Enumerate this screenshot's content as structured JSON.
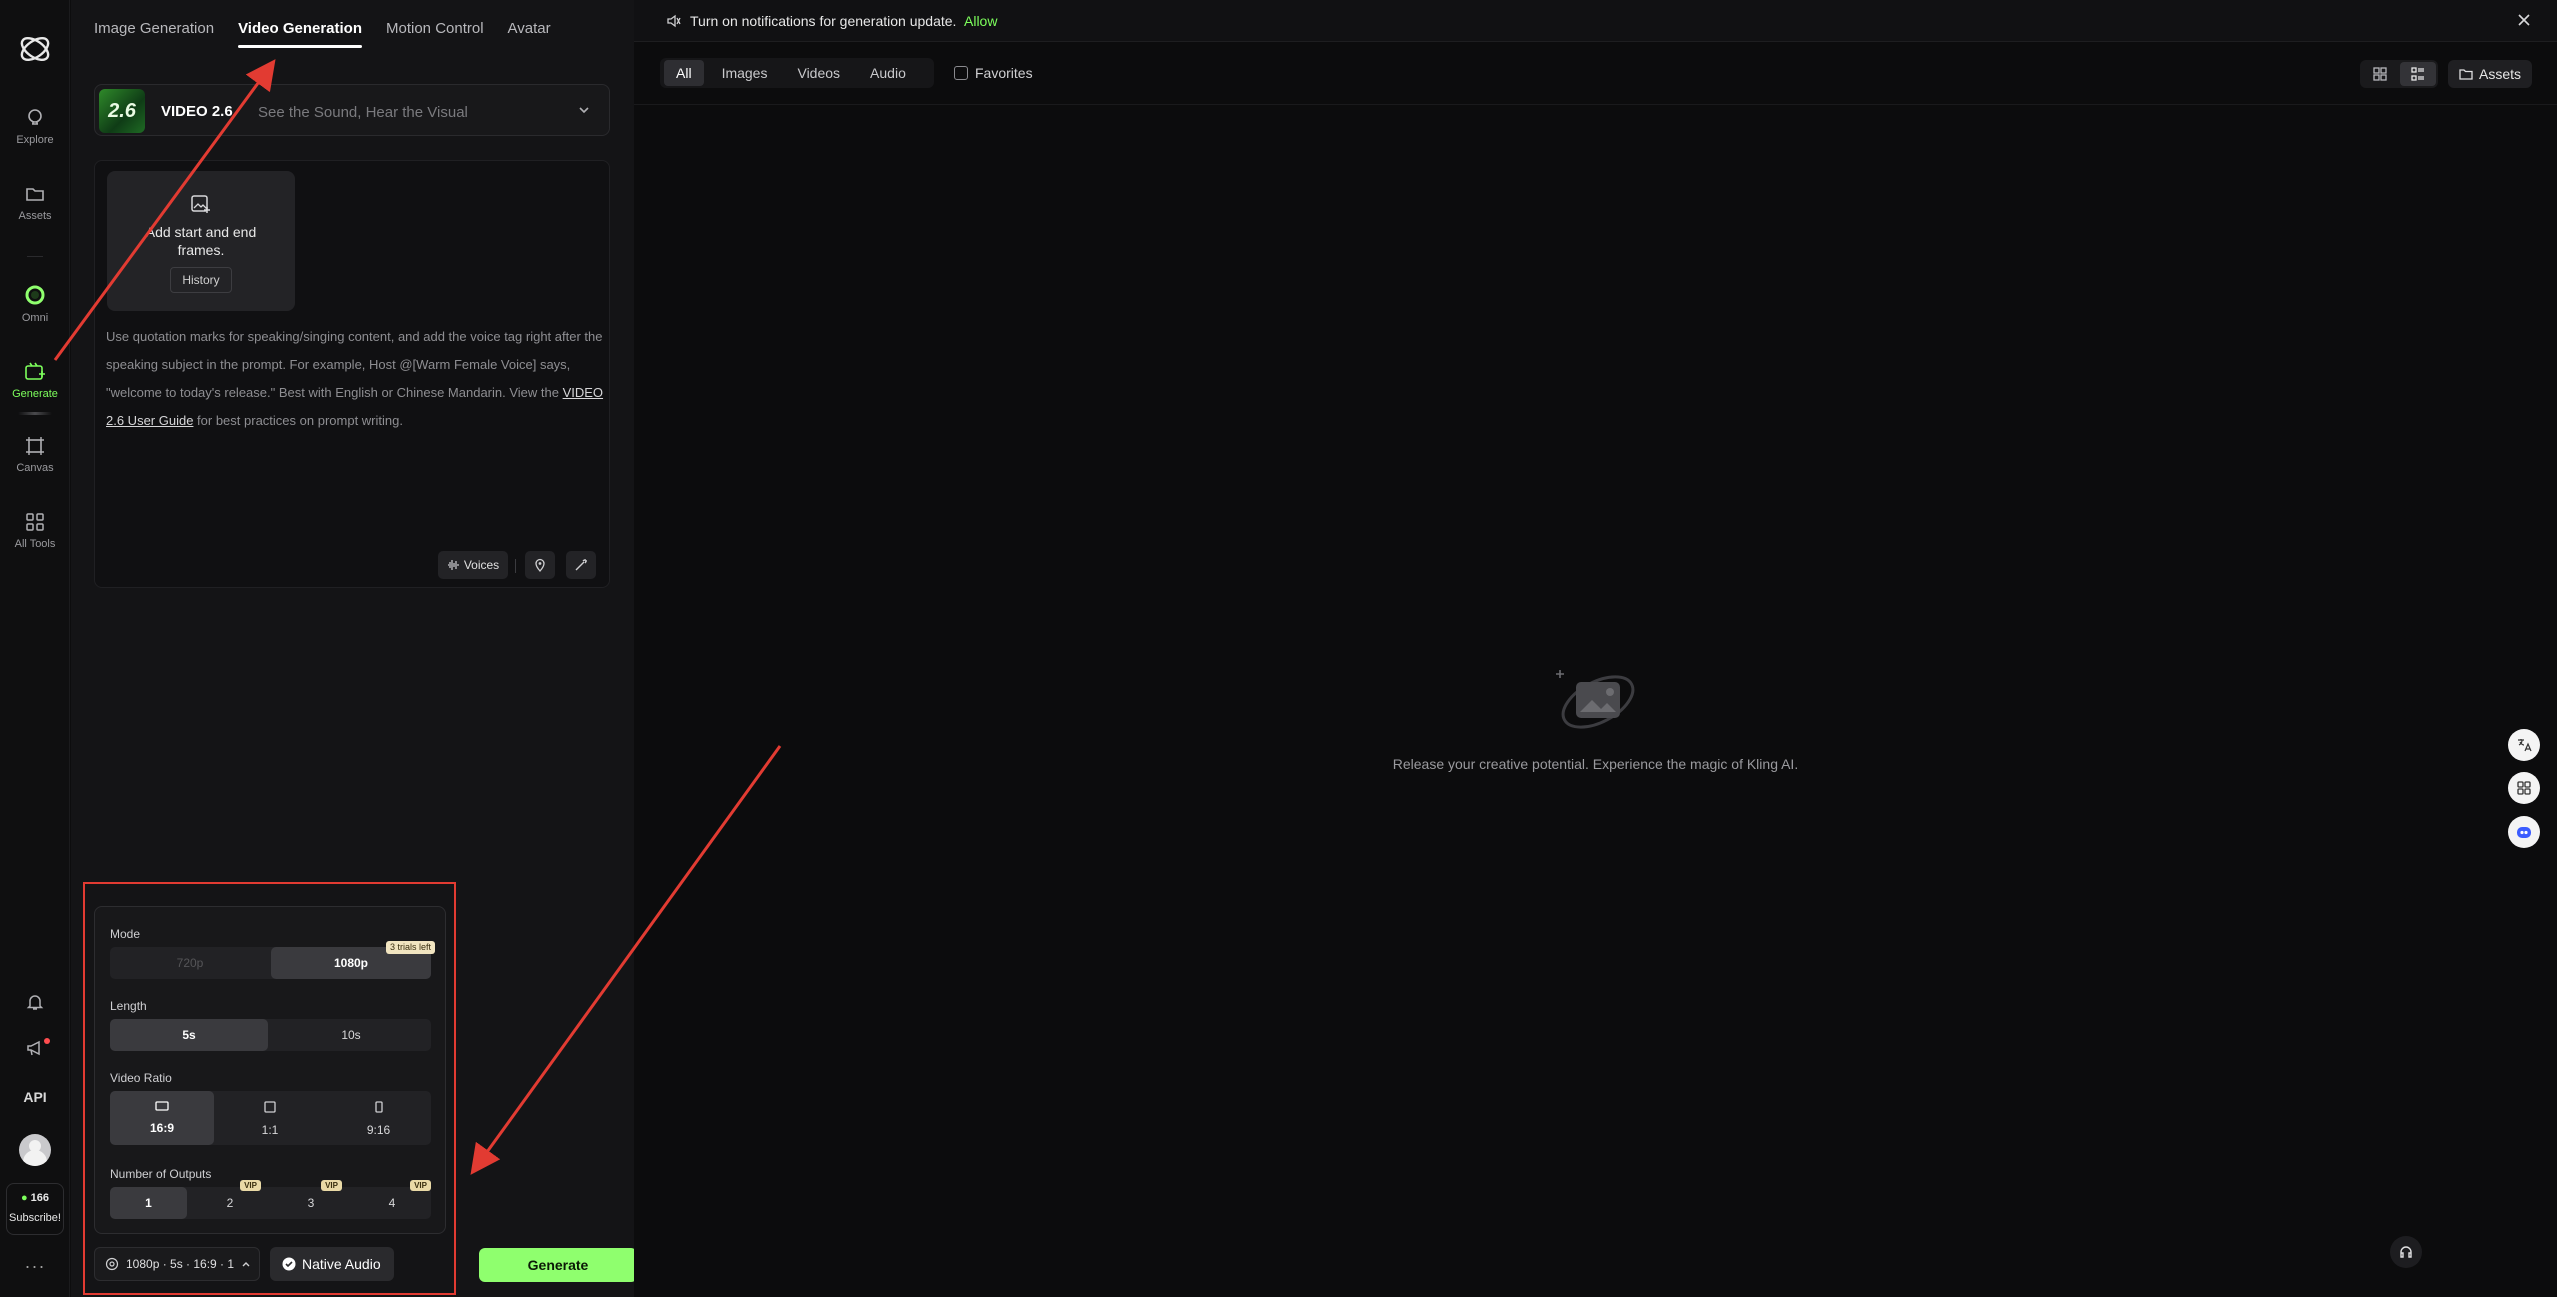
{
  "nav": {
    "items": [
      {
        "label": "Explore",
        "icon": "bulb-icon"
      },
      {
        "label": "Assets",
        "icon": "folder-icon"
      },
      {
        "label": "Omni",
        "icon": "omni-ring-icon"
      },
      {
        "label": "Generate",
        "icon": "generate-icon",
        "active": true
      },
      {
        "label": "Canvas",
        "icon": "canvas-icon"
      },
      {
        "label": "All Tools",
        "icon": "grid-icon"
      }
    ],
    "api_label": "API",
    "points": "166",
    "subscribe_label": "Subscribe!",
    "more": "···"
  },
  "tabs": [
    "Image Generation",
    "Video Generation",
    "Motion Control",
    "Avatar"
  ],
  "model": {
    "badge": "2.6",
    "name": "VIDEO 2.6",
    "tagline": "See the Sound, Hear the Visual"
  },
  "prompt": {
    "frames_label": "Add start and end frames.",
    "history_label": "History",
    "hint_text": "Use quotation marks for speaking/singing content, and add the voice tag right after the speaking subject in the prompt. For example, Host @[Warm Female Voice] says, \"welcome to today's release.\" Best with English or Chinese Mandarin. View the ",
    "guide_link": "VIDEO 2.6 User Guide",
    "hint_tail": " for best practices on prompt writing.",
    "voices_label": "Voices"
  },
  "settings": {
    "mode_label": "Mode",
    "mode_options": [
      "720p",
      "1080p"
    ],
    "trials_badge": "3 trials left",
    "length_label": "Length",
    "length_options": [
      "5s",
      "10s"
    ],
    "ratio_label": "Video Ratio",
    "ratio_options": [
      "16:9",
      "1:1",
      "9:16"
    ],
    "outputs_label": "Number of Outputs",
    "outputs_options": [
      "1",
      "2",
      "3",
      "4"
    ],
    "vip_badge": "VIP"
  },
  "bottom": {
    "summary": "1080p · 5s · 16:9 · 1",
    "native_audio": "Native Audio",
    "generate": "Generate"
  },
  "main": {
    "notification": "Turn on notifications for generation update.",
    "allow": "Allow",
    "filters": [
      "All",
      "Images",
      "Videos",
      "Audio"
    ],
    "favorites": "Favorites",
    "assets_label": "Assets",
    "empty_message": "Release your creative potential. Experience the magic of Kling AI."
  },
  "colors": {
    "accent": "#8fff6e",
    "annotation": "#e23b32"
  }
}
